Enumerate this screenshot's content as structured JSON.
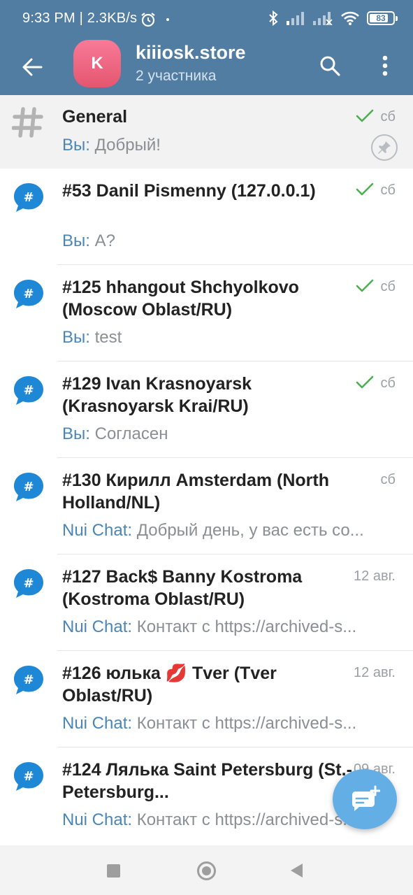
{
  "status_bar": {
    "time": "9:33 PM | 2.3KB/s",
    "battery": "83",
    "icons": [
      "alarm-icon",
      "bluetooth-icon",
      "signal-icon",
      "signal-off-icon",
      "wifi-icon",
      "battery-icon"
    ]
  },
  "header": {
    "avatar_letter": "K",
    "title": "kiiiosk.store",
    "subtitle": "2 участника"
  },
  "chats": [
    {
      "name": "General",
      "sender": "Вы:",
      "text": " Добрый!",
      "date": "сб",
      "read": true,
      "pinned": true,
      "icon": "hash-icon"
    },
    {
      "name": "#53 Danil Pismenny (127.0.0.1)",
      "sender": "Вы:",
      "text": " А?",
      "date": "сб",
      "read": true
    },
    {
      "name": "#125 hhangout Shchyolkovo (Moscow Oblast/RU)",
      "sender": "Вы:",
      "text": " test",
      "date": "сб",
      "read": true
    },
    {
      "name": "#129 Ivan Krasnoyarsk (Krasnoyarsk Krai/RU)",
      "sender": "Вы:",
      "text": " Согласен",
      "date": "сб",
      "read": true
    },
    {
      "name": "#130 Кирилл Amsterdam (North Holland/NL)",
      "sender": "Nui Chat:",
      "text": " Добрый день, у вас есть со...",
      "date": "сб",
      "read": false
    },
    {
      "name": "#127 Back$ Banny Kostroma (Kostroma Oblast/RU)",
      "sender": "Nui Chat:",
      "text": " Контакт с https://archived-s...",
      "date": "12 авг.",
      "read": false
    },
    {
      "name": "#126 юлька 💋 Tver (Tver Oblast/RU)",
      "sender": "Nui Chat:",
      "text": " Контакт с https://archived-s...",
      "date": "12 авг.",
      "read": false
    },
    {
      "name": "#124 Лялька Saint Petersburg (St.-Petersburg...",
      "sender": "Nui Chat:",
      "text": " Контакт с https://archived-s...",
      "date": "09 авг.",
      "read": false
    }
  ],
  "colors": {
    "header": "#527da3",
    "accent": "#64aee6",
    "sender": "#4a86b6",
    "read_check": "#4caf50"
  }
}
